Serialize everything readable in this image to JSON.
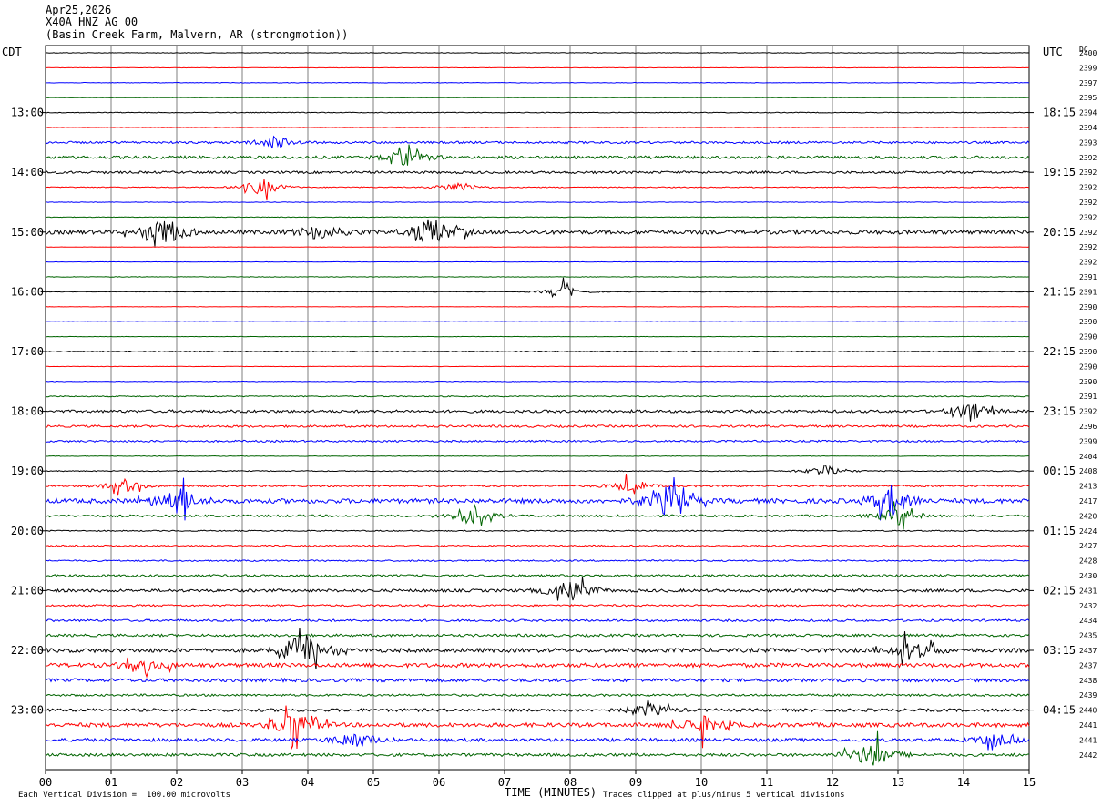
{
  "header": {
    "date": "Apr25,2026",
    "station": "X40A HNZ AG 00",
    "location": "(Basin Creek Farm, Malvern, AR (strongmotion))"
  },
  "labels": {
    "left_tz": "CDT",
    "right_tz": "UTC",
    "dc": "DC",
    "xlabel": "TIME (MINUTES)",
    "footer_left": "Each Vertical Division =  100.00 microvolts",
    "footer_right": "Traces clipped at plus/minus 5 vertical divisions"
  },
  "chart_data": {
    "type": "line",
    "title": "X40A HNZ AG 00",
    "xlabel": "TIME (MINUTES)",
    "xlim": [
      0,
      15
    ],
    "x_ticks": [
      "00",
      "01",
      "02",
      "03",
      "04",
      "05",
      "06",
      "07",
      "08",
      "09",
      "10",
      "11",
      "12",
      "13",
      "14",
      "15"
    ],
    "rows_per_hour": 4,
    "trace_colors": [
      "#000000",
      "#ff0000",
      "#0000ff",
      "#006400"
    ],
    "left_ticks": [
      "13:00",
      "14:00",
      "15:00",
      "16:00",
      "17:00",
      "18:00",
      "19:00",
      "20:00",
      "21:00",
      "22:00",
      "23:00"
    ],
    "right_ticks": [
      "18:15",
      "19:15",
      "20:15",
      "21:15",
      "22:15",
      "23:15",
      "00:15",
      "01:15",
      "02:15",
      "03:15",
      "04:15"
    ],
    "dc_offsets": [
      "2400",
      "2399",
      "2397",
      "2395",
      "2394",
      "2394",
      "2393",
      "2392",
      "2392",
      "2392",
      "2392",
      "2392",
      "2392",
      "2392",
      "2392",
      "2391",
      "2391",
      "2390",
      "2390",
      "2390",
      "2390",
      "2390",
      "2390",
      "2391",
      "2392",
      "2396",
      "2399",
      "2404",
      "2408",
      "2413",
      "2417",
      "2420",
      "2424",
      "2427",
      "2428",
      "2430",
      "2431",
      "2432",
      "2434",
      "2435",
      "2437",
      "2437",
      "2438",
      "2439",
      "2440",
      "2441",
      "2441",
      "2442"
    ],
    "amplitude": [
      0.3,
      0.2,
      0.3,
      0.2,
      0.4,
      0.2,
      1.2,
      1.6,
      1.3,
      0.5,
      0.3,
      0.3,
      2.2,
      0.2,
      0.2,
      0.3,
      0.3,
      0.2,
      0.2,
      0.2,
      0.5,
      0.2,
      0.3,
      0.6,
      1.5,
      1.2,
      1.0,
      0.3,
      0.5,
      1.0,
      2.5,
      1.2,
      0.6,
      0.8,
      0.8,
      1.2,
      1.6,
      1.0,
      1.2,
      1.4,
      2.2,
      2.2,
      1.8,
      1.2,
      1.6,
      2.2,
      1.8,
      1.6
    ],
    "events": [
      {
        "row": 6,
        "minute": 3.5,
        "amp": 2
      },
      {
        "row": 7,
        "minute": 5.5,
        "amp": 2.5
      },
      {
        "row": 9,
        "minute": 3.3,
        "amp": 3
      },
      {
        "row": 9,
        "minute": 6.3,
        "amp": 2
      },
      {
        "row": 12,
        "minute": 1.8,
        "amp": 5
      },
      {
        "row": 12,
        "minute": 4.2,
        "amp": 3
      },
      {
        "row": 12,
        "minute": 5.9,
        "amp": 5
      },
      {
        "row": 16,
        "minute": 7.9,
        "amp": 2
      },
      {
        "row": 24,
        "minute": 14.1,
        "amp": 3
      },
      {
        "row": 28,
        "minute": 11.9,
        "amp": 2
      },
      {
        "row": 29,
        "minute": 1.2,
        "amp": 2
      },
      {
        "row": 29,
        "minute": 8.9,
        "amp": 2
      },
      {
        "row": 30,
        "minute": 2.0,
        "amp": 5
      },
      {
        "row": 30,
        "minute": 9.5,
        "amp": 5
      },
      {
        "row": 30,
        "minute": 12.9,
        "amp": 5
      },
      {
        "row": 31,
        "minute": 6.5,
        "amp": 3
      },
      {
        "row": 31,
        "minute": 13.0,
        "amp": 3
      },
      {
        "row": 36,
        "minute": 8.0,
        "amp": 4
      },
      {
        "row": 40,
        "minute": 4.0,
        "amp": 5
      },
      {
        "row": 40,
        "minute": 13.2,
        "amp": 4
      },
      {
        "row": 41,
        "minute": 1.5,
        "amp": 2
      },
      {
        "row": 44,
        "minute": 9.2,
        "amp": 2
      },
      {
        "row": 45,
        "minute": 3.8,
        "amp": 5
      },
      {
        "row": 45,
        "minute": 10.0,
        "amp": 3
      },
      {
        "row": 46,
        "minute": 4.7,
        "amp": 3
      },
      {
        "row": 46,
        "minute": 14.5,
        "amp": 2
      },
      {
        "row": 47,
        "minute": 12.6,
        "amp": 5
      }
    ]
  }
}
